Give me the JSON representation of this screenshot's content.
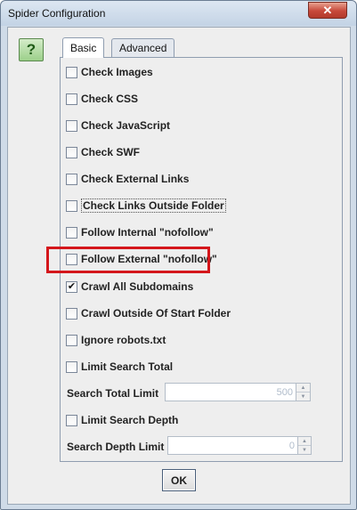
{
  "window": {
    "title": "Spider Configuration",
    "close_glyph": "✕"
  },
  "help": {
    "glyph": "?"
  },
  "tabs": [
    {
      "label": "Basic",
      "active": true
    },
    {
      "label": "Advanced",
      "active": false
    }
  ],
  "options": [
    {
      "label": "Check Images",
      "checked": false
    },
    {
      "label": "Check CSS",
      "checked": false
    },
    {
      "label": "Check JavaScript",
      "checked": false
    },
    {
      "label": "Check SWF",
      "checked": false
    },
    {
      "label": "Check External Links",
      "checked": false
    },
    {
      "label": "Check Links Outside Folder",
      "checked": false
    },
    {
      "label": "Follow Internal \"nofollow\"",
      "checked": false
    },
    {
      "label": "Follow External \"nofollow\"",
      "checked": false
    },
    {
      "label": "Crawl All Subdomains",
      "checked": true
    },
    {
      "label": "Crawl Outside Of Start Folder",
      "checked": false
    },
    {
      "label": "Ignore robots.txt",
      "checked": false
    },
    {
      "label": "Limit Search Total",
      "checked": false
    },
    {
      "label": "Limit Search Depth",
      "checked": false
    }
  ],
  "search_total_limit": {
    "label": "Search Total Limit",
    "value": "500"
  },
  "search_depth_limit": {
    "label": "Search Depth Limit",
    "value": "0"
  },
  "check_glyph": "✔",
  "ok_label": "OK",
  "colors": {
    "highlight": "#d4161b",
    "help_icon": "#9cd08a",
    "close_button": "#c7483a"
  }
}
